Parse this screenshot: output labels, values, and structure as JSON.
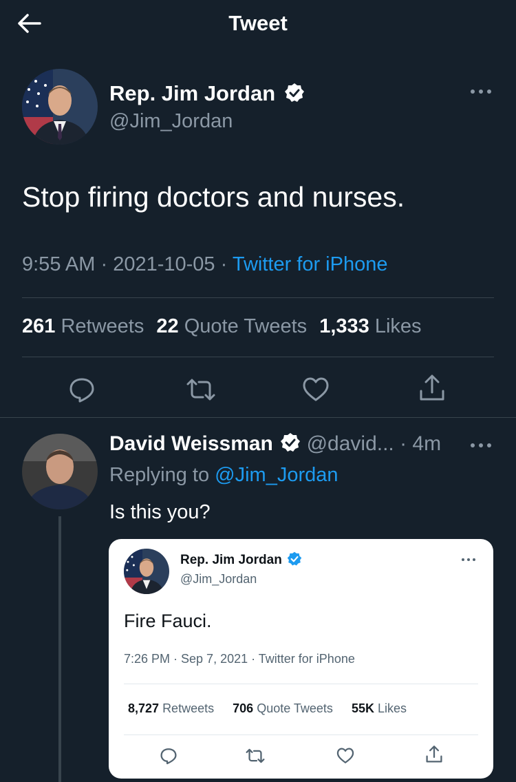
{
  "header": {
    "title": "Tweet"
  },
  "main_tweet": {
    "name": "Rep. Jim Jordan",
    "handle": "@Jim_Jordan",
    "text": "Stop firing doctors and nurses.",
    "time": "9:55 AM",
    "date": "2021-10-05",
    "source": "Twitter for iPhone",
    "sep": "·",
    "stats": {
      "retweets": "261",
      "retweets_label": "Retweets",
      "quotes": "22",
      "quotes_label": "Quote Tweets",
      "likes": "1,333",
      "likes_label": "Likes"
    }
  },
  "reply": {
    "name": "David Weissman",
    "handle": "@david...",
    "age": "· 4m",
    "replying_to_label": "Replying to",
    "replying_to": "@Jim_Jordan",
    "text": "Is this you?"
  },
  "embedded": {
    "name": "Rep. Jim Jordan",
    "handle": "@Jim_Jordan",
    "text": "Fire Fauci.",
    "meta": "7:26 PM · Sep 7, 2021 · Twitter for iPhone",
    "stats": {
      "retweets": "8,727",
      "retweets_label": "Retweets",
      "quotes": "706",
      "quotes_label": "Quote Tweets",
      "likes": "55K",
      "likes_label": "Likes"
    }
  },
  "colors": {
    "background": "#15202b",
    "accent": "#1d9bf0",
    "muted": "#8b98a5",
    "divider": "#38444d"
  }
}
